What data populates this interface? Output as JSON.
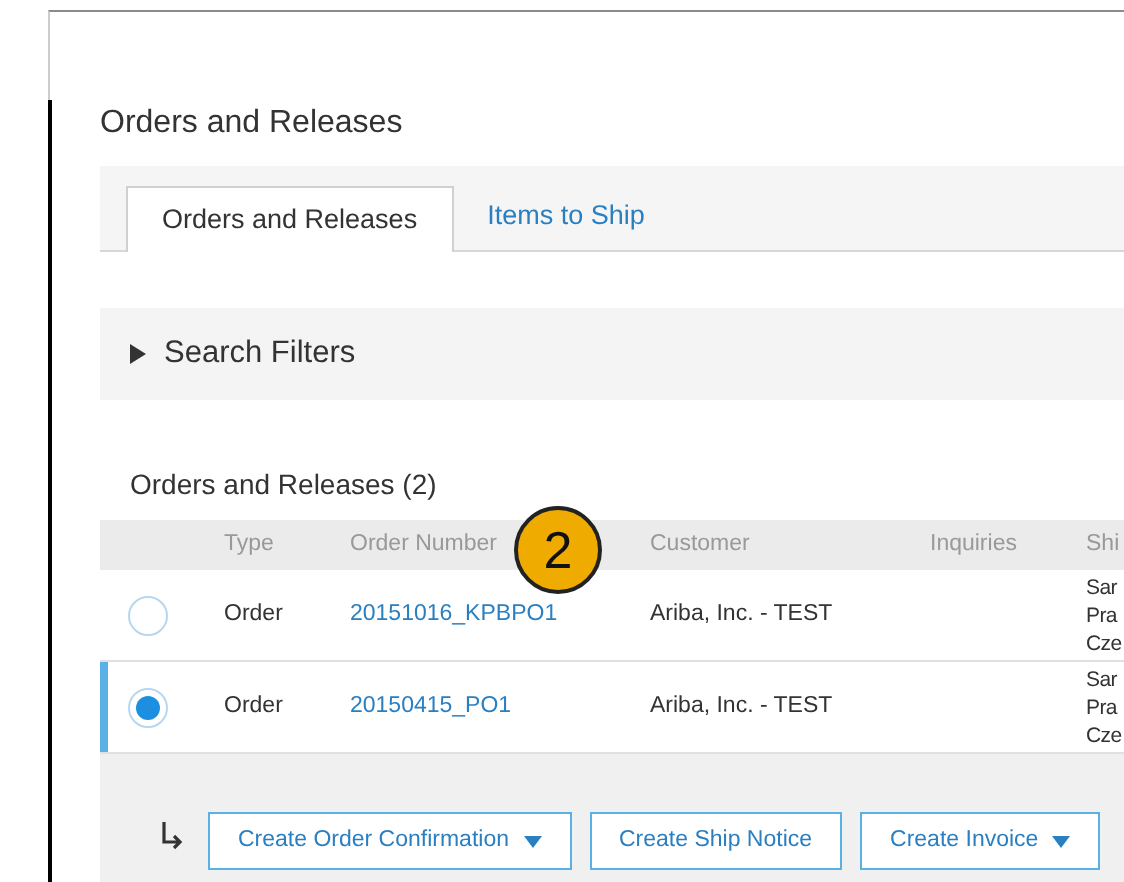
{
  "page_title": "Orders and Releases",
  "tabs": [
    {
      "label": "Orders and Releases",
      "selected": true
    },
    {
      "label": "Items to Ship",
      "selected": false
    }
  ],
  "search_filters": {
    "label": "Search Filters",
    "expanded": false
  },
  "table": {
    "title": "Orders and Releases (2)",
    "columns": [
      "Type",
      "Order Number",
      "Customer",
      "Inquiries",
      "Shi"
    ],
    "rows": [
      {
        "selected": false,
        "type": "Order",
        "order_number": "20151016_KPBPO1",
        "customer": "Ariba, Inc. - TEST",
        "ship_to": [
          "Sar",
          "Pra",
          "Cze"
        ]
      },
      {
        "selected": true,
        "type": "Order",
        "order_number": "20150415_PO1",
        "customer": "Ariba, Inc. - TEST",
        "ship_to": [
          "Sar",
          "Pra",
          "Cze"
        ]
      }
    ]
  },
  "callout": "2",
  "actions": [
    {
      "label": "Create Order Confirmation",
      "dropdown": true
    },
    {
      "label": "Create Ship Notice",
      "dropdown": false
    },
    {
      "label": "Create Invoice",
      "dropdown": true
    }
  ]
}
